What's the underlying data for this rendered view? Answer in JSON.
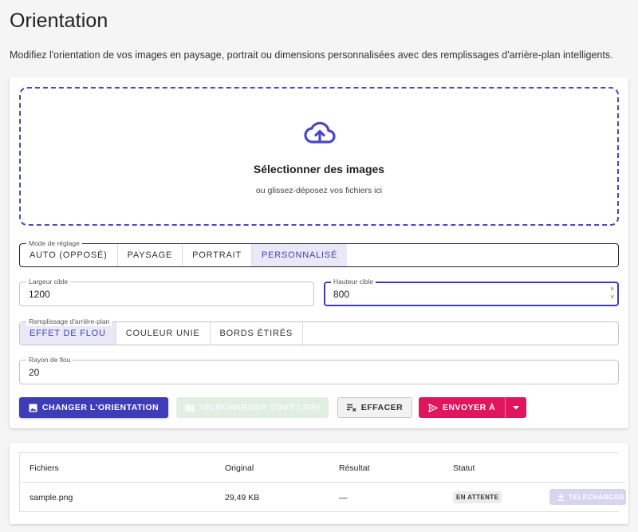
{
  "header": {
    "title": "Orientation",
    "description": "Modifiez l'orientation de vos images en paysage, portrait ou dimensions personnalisées avec des remplissages d'arrière-plan intelligents."
  },
  "dropzone": {
    "title": "Sélectionner des images",
    "subtitle": "ou glissez-déposez vos fichiers ici",
    "icon": "cloud-upload-icon"
  },
  "adjust_mode": {
    "legend": "Mode de réglage",
    "options": [
      "AUTO (OPPOSÉ)",
      "PAYSAGE",
      "PORTRAIT",
      "PERSONNALISÉ"
    ],
    "selected": "PERSONNALISÉ"
  },
  "target_width": {
    "label": "Largeur cible",
    "value": "1200"
  },
  "target_height": {
    "label": "Hauteur cible",
    "value": "800"
  },
  "background_fill": {
    "legend": "Remplissage d'arrière-plan",
    "options": [
      "EFFET DE FLOU",
      "COULEUR UNIE",
      "BORDS ÉTIRÉS"
    ],
    "selected": "EFFET DE FLOU"
  },
  "blur_radius": {
    "label": "Rayon de flou",
    "value": "20"
  },
  "actions": {
    "change_orientation": "CHANGER L'ORIENTATION",
    "download_all": "TÉLÉCHARGER TOUT (.ZIP)",
    "clear": "EFFACER",
    "send_to": "ENVOYER À"
  },
  "table": {
    "headers": [
      "Fichiers",
      "Original",
      "Résultat",
      "Statut"
    ],
    "rows": [
      {
        "file": "sample.png",
        "original": "29,49 KB",
        "result": "—",
        "status": "EN ATTENTE",
        "action": "TÉLÉCHARGER"
      }
    ]
  },
  "colors": {
    "primary": "#3f3cb8",
    "accent_pink": "#e0165c",
    "background": "#f5f5f5"
  }
}
